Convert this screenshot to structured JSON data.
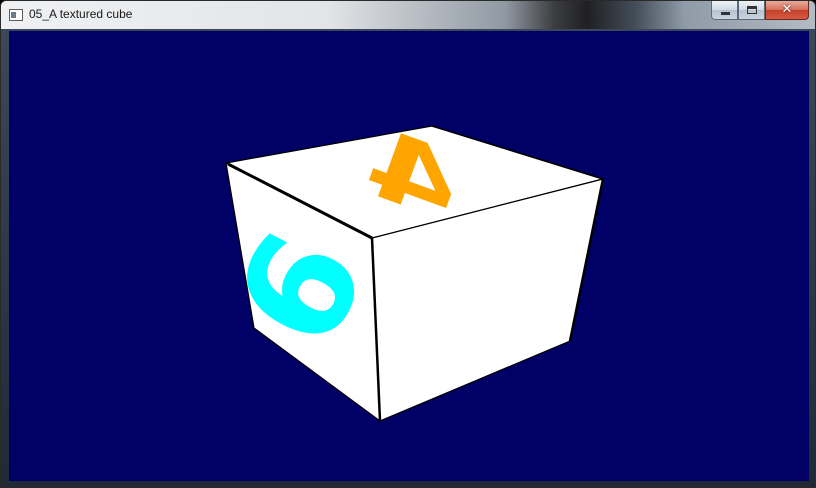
{
  "window": {
    "title": "05_A textured cube",
    "icon": "app-window-icon",
    "controls": {
      "minimize_icon": "minimize-icon",
      "maximize_icon": "maximize-icon",
      "close_icon": "close-icon",
      "close_glyph": "✕"
    }
  },
  "scene": {
    "background_color": "#000066",
    "cube": {
      "face_color": "#ffffff",
      "edge_color": "#000000",
      "top_face": {
        "glyph": "4",
        "glyph_color": "#ffa500"
      },
      "left_face": {
        "glyph": "6",
        "glyph_color": "#00ffff"
      },
      "right_face": {
        "glyph": "",
        "glyph_color": "#ffffff"
      }
    }
  }
}
